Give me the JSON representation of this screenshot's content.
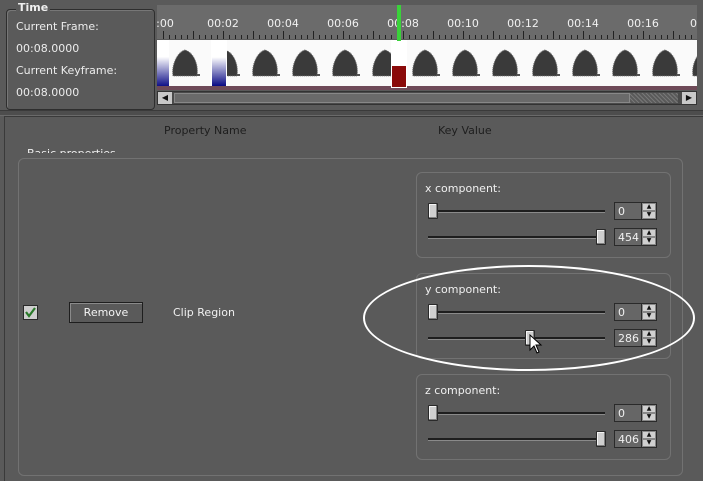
{
  "time": {
    "title": "Time",
    "current_frame_label": "Current Frame:",
    "current_frame_value": "00:08.0000",
    "current_keyframe_label": "Current Keyframe:",
    "current_keyframe_value": "00:08.0000"
  },
  "ruler": {
    "ticks": [
      ":00",
      "00:02",
      "00:04",
      "00:06",
      "00:08",
      "00:10",
      "00:12",
      "00:14",
      "00:16",
      "00"
    ]
  },
  "headers": {
    "property_name": "Property Name",
    "key_value": "Key Value"
  },
  "basic": {
    "legend": "Basic properties",
    "checkbox_checked": true,
    "remove_label": "Remove",
    "property": "Clip Region"
  },
  "components": [
    {
      "label": "x component:",
      "min_value": "0",
      "max_value": "454"
    },
    {
      "label": "y component:",
      "min_value": "0",
      "max_value": "286"
    },
    {
      "label": "z component:",
      "min_value": "0",
      "max_value": "406"
    }
  ],
  "colors": {
    "background": "#5a5a5a",
    "cursor": "#3ad23a",
    "keyframe": "#000080"
  }
}
